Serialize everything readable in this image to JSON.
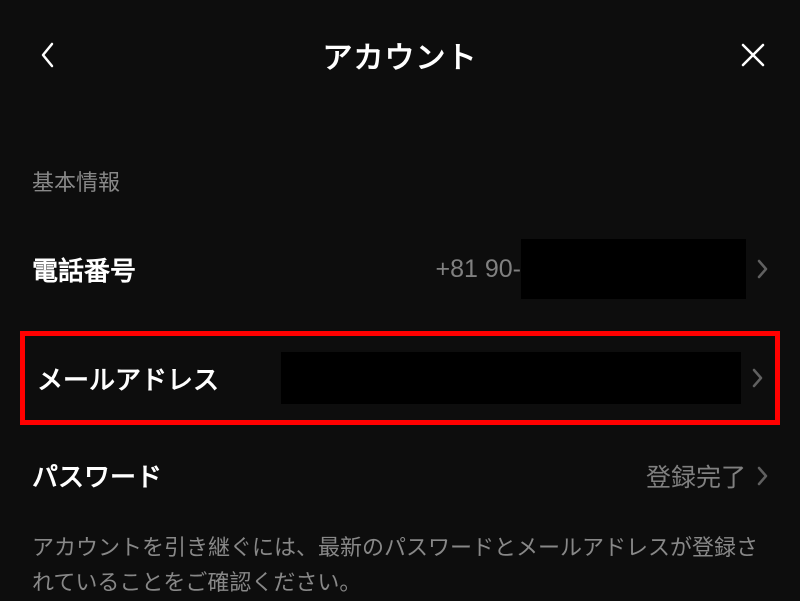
{
  "header": {
    "title": "アカウント"
  },
  "section": {
    "basic_info_label": "基本情報"
  },
  "rows": {
    "phone": {
      "label": "電話番号",
      "value_prefix": "+81 90-"
    },
    "email": {
      "label": "メールアドレス"
    },
    "password": {
      "label": "パスワード",
      "value": "登録完了"
    }
  },
  "footer": {
    "text": "アカウントを引き継ぐには、最新のパスワードとメールアドレスが登録されていることをご確認ください。"
  }
}
